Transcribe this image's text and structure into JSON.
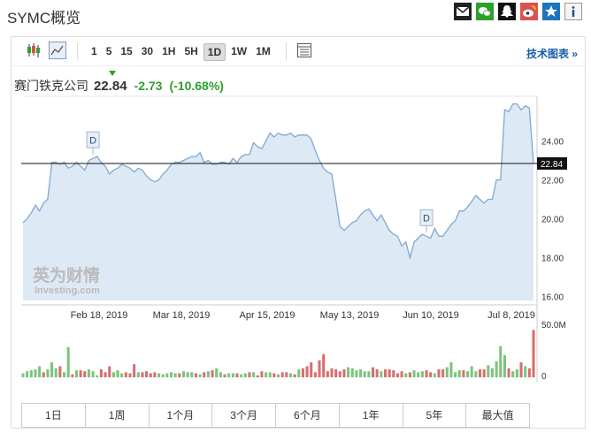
{
  "header": {
    "title": "SYMC概览"
  },
  "share_icons": [
    "mail-icon",
    "wechat-icon",
    "snapchat-icon",
    "weibo-icon",
    "star-icon",
    "info-icon"
  ],
  "toolbar": {
    "periods": [
      "1",
      "5",
      "15",
      "30",
      "1H",
      "5H",
      "1D",
      "1W",
      "1M"
    ],
    "active_period": "1D",
    "tech_link": "技术图表 »"
  },
  "quote": {
    "name": "赛门铁克公司",
    "price": "22.84",
    "change": "-2.73",
    "change_pct": "(-10.68%)"
  },
  "watermark": {
    "cn": "英为财情",
    "en": "Investing.com"
  },
  "range_buttons": [
    "1日",
    "1周",
    "1个月",
    "3个月",
    "6个月",
    "1年",
    "5年",
    "最大值"
  ],
  "colors": {
    "line": "#7fa9d1",
    "area": "#dde9f4",
    "up": "#2ca02c",
    "down": "#d9534f",
    "vol_up": "#7cc47c",
    "vol_down": "#d66f6f",
    "link": "#1a5ea8"
  },
  "chart_data": {
    "type": "area",
    "x_ticks": [
      "Feb 18, 2019",
      "Mar 18, 2019",
      "Apr 15, 2019",
      "May 13, 2019",
      "Jun 10, 2019",
      "Jul 8, 2019"
    ],
    "y_ticks": [
      16,
      18,
      20,
      22,
      24
    ],
    "y_tick_labels": [
      "16.00",
      "18.00",
      "20.00",
      "22.00",
      "24.00"
    ],
    "ylim": [
      15.8,
      26.2
    ],
    "last_price": 22.84,
    "last_price_label": "22.84",
    "volume_max_label": "50.0M",
    "volume_zero_label": "0",
    "dividend_markers": [
      {
        "index": 17,
        "label": "D"
      },
      {
        "index": 98,
        "label": "D"
      }
    ],
    "prices": [
      19.8,
      20.0,
      20.3,
      20.7,
      20.4,
      20.8,
      21.0,
      22.9,
      22.9,
      22.8,
      22.9,
      22.6,
      22.7,
      22.9,
      22.7,
      22.5,
      23.0,
      23.1,
      23.2,
      22.9,
      22.7,
      22.3,
      22.5,
      22.6,
      22.8,
      22.7,
      22.6,
      22.4,
      22.6,
      22.5,
      22.2,
      22.0,
      21.9,
      22.0,
      22.3,
      22.5,
      22.8,
      22.9,
      22.9,
      23.0,
      23.1,
      23.2,
      23.2,
      23.4,
      22.9,
      23.0,
      22.8,
      22.8,
      22.9,
      22.9,
      22.8,
      23.1,
      22.9,
      23.2,
      23.3,
      23.3,
      23.9,
      23.7,
      23.6,
      24.0,
      24.4,
      24.2,
      24.4,
      24.3,
      24.3,
      24.4,
      24.2,
      24.3,
      24.3,
      24.3,
      24.1,
      23.5,
      23.0,
      22.6,
      22.4,
      22.3,
      21.0,
      19.6,
      19.4,
      19.6,
      19.8,
      19.9,
      20.2,
      20.4,
      20.5,
      20.2,
      19.9,
      20.2,
      19.8,
      19.4,
      19.2,
      19.1,
      18.6,
      18.8,
      18.0,
      18.8,
      19.0,
      19.2,
      19.1,
      19.0,
      19.5,
      19.1,
      19.1,
      19.4,
      19.7,
      19.9,
      20.4,
      20.4,
      20.6,
      20.9,
      21.2,
      21.0,
      20.8,
      21.0,
      21.0,
      22.0,
      22.0,
      25.6,
      25.5,
      25.9,
      25.9,
      25.6,
      25.8,
      25.7,
      22.84
    ],
    "volumes": [
      4,
      6,
      7,
      8,
      11,
      5,
      8,
      15,
      9,
      11,
      5,
      30,
      3,
      7,
      7,
      6,
      8,
      6,
      2,
      8,
      5,
      11,
      5,
      7,
      4,
      5,
      4,
      13,
      5,
      5,
      6,
      4,
      5,
      4,
      3,
      4,
      5,
      4,
      4,
      6,
      5,
      5,
      4,
      3,
      5,
      6,
      7,
      9,
      5,
      3,
      4,
      4,
      4,
      3,
      4,
      5,
      5,
      2,
      6,
      5,
      5,
      4,
      3,
      5,
      5,
      4,
      3,
      8,
      9,
      11,
      15,
      5,
      17,
      23,
      6,
      9,
      8,
      6,
      8,
      10,
      9,
      7,
      8,
      6,
      6,
      10,
      8,
      6,
      8,
      8,
      7,
      4,
      6,
      4,
      5,
      7,
      5,
      6,
      7,
      5,
      4,
      8,
      8,
      10,
      15,
      5,
      7,
      7,
      6,
      11,
      6,
      8,
      8,
      12,
      9,
      16,
      31,
      22,
      9,
      6,
      8,
      15,
      11,
      9,
      47
    ],
    "volume_direction": [
      1,
      1,
      1,
      1,
      1,
      0,
      1,
      1,
      1,
      0,
      1,
      1,
      0,
      1,
      0,
      0,
      1,
      1,
      1,
      0,
      0,
      0,
      1,
      1,
      1,
      0,
      0,
      0,
      1,
      0,
      0,
      0,
      0,
      1,
      1,
      1,
      1,
      1,
      0,
      1,
      1,
      1,
      0,
      1,
      0,
      1,
      0,
      1,
      1,
      0,
      1,
      1,
      0,
      1,
      1,
      0,
      1,
      0,
      0,
      1,
      1,
      0,
      1,
      0,
      0,
      1,
      0,
      1,
      0,
      0,
      0,
      0,
      0,
      0,
      0,
      0,
      0,
      0,
      0,
      1,
      1,
      1,
      1,
      1,
      1,
      0,
      0,
      1,
      0,
      0,
      0,
      0,
      0,
      1,
      0,
      1,
      1,
      1,
      0,
      0,
      1,
      0,
      0,
      1,
      1,
      1,
      1,
      0,
      1,
      1,
      1,
      0,
      0,
      1,
      1,
      1,
      1,
      1,
      0,
      1,
      1,
      0,
      1,
      0,
      0
    ]
  }
}
